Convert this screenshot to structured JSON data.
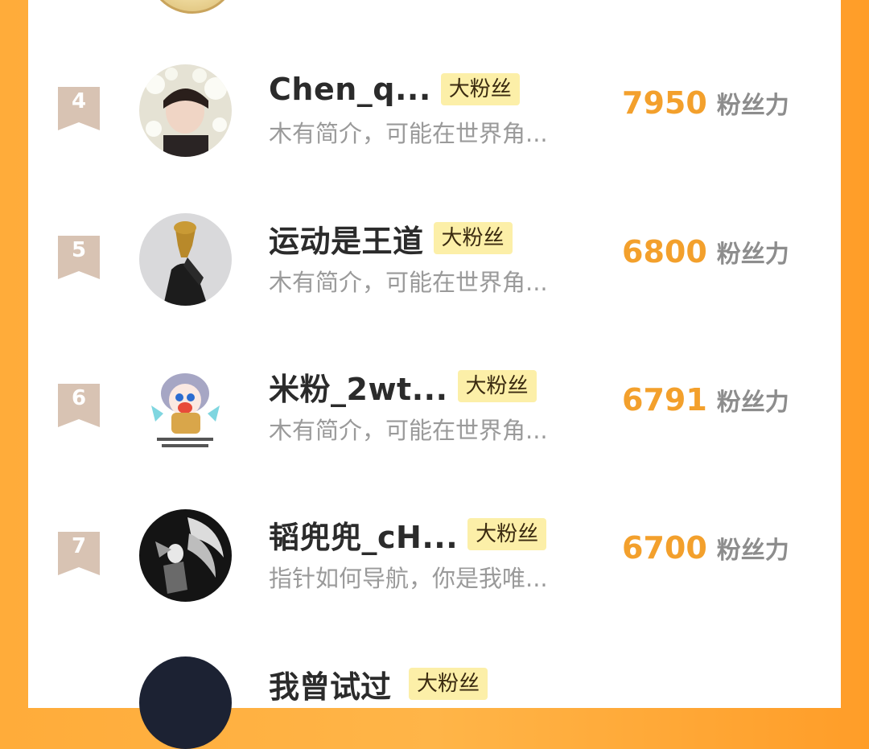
{
  "fan_label": "粉丝力",
  "rows": [
    {
      "rank": "4",
      "name": "Chen_q...",
      "badge": "大粉丝",
      "bio": "木有简介，可能在世界角...",
      "score": "7950"
    },
    {
      "rank": "5",
      "name": "运动是王道",
      "badge": "大粉丝",
      "bio": "木有简介，可能在世界角...",
      "score": "6800"
    },
    {
      "rank": "6",
      "name": "米粉_2wt...",
      "badge": "大粉丝",
      "bio": "木有简介，可能在世界角...",
      "score": "6791"
    },
    {
      "rank": "7",
      "name": "韬兜兜_cH...",
      "badge": "大粉丝",
      "bio": "指针如何导航，你是我唯...",
      "score": "6700"
    }
  ],
  "partial_row": {
    "name": "我曾试过",
    "badge": "大粉丝"
  },
  "colors": {
    "accent_orange": "#f3a02c",
    "background_orange": "#ffac3a",
    "badge_yellow": "#fcefa8",
    "rank_badge": "#d8c3b3"
  }
}
